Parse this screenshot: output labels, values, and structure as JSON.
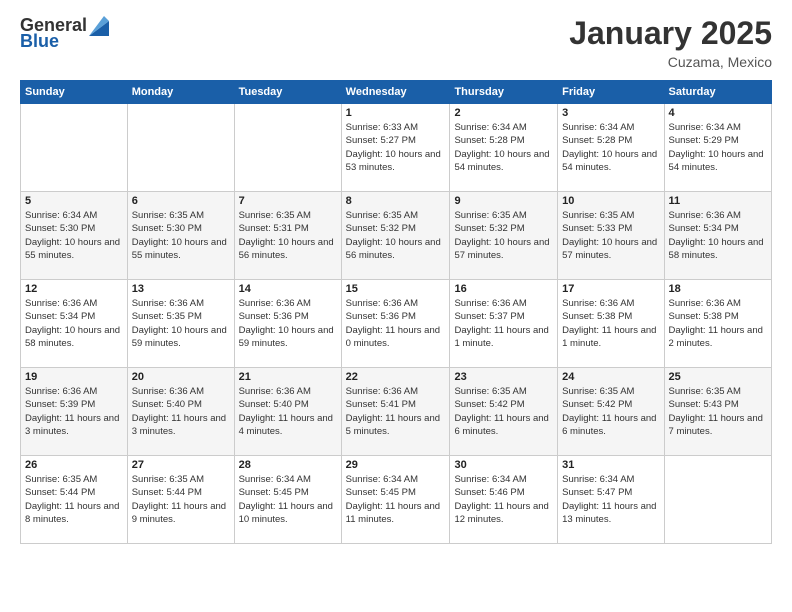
{
  "header": {
    "logo": {
      "general": "General",
      "blue": "Blue"
    },
    "title": "January 2025",
    "location": "Cuzama, Mexico"
  },
  "weekdays": [
    "Sunday",
    "Monday",
    "Tuesday",
    "Wednesday",
    "Thursday",
    "Friday",
    "Saturday"
  ],
  "weeks": [
    [
      {
        "day": "",
        "sunrise": "",
        "sunset": "",
        "daylight": ""
      },
      {
        "day": "",
        "sunrise": "",
        "sunset": "",
        "daylight": ""
      },
      {
        "day": "",
        "sunrise": "",
        "sunset": "",
        "daylight": ""
      },
      {
        "day": "1",
        "sunrise": "Sunrise: 6:33 AM",
        "sunset": "Sunset: 5:27 PM",
        "daylight": "Daylight: 10 hours and 53 minutes."
      },
      {
        "day": "2",
        "sunrise": "Sunrise: 6:34 AM",
        "sunset": "Sunset: 5:28 PM",
        "daylight": "Daylight: 10 hours and 54 minutes."
      },
      {
        "day": "3",
        "sunrise": "Sunrise: 6:34 AM",
        "sunset": "Sunset: 5:28 PM",
        "daylight": "Daylight: 10 hours and 54 minutes."
      },
      {
        "day": "4",
        "sunrise": "Sunrise: 6:34 AM",
        "sunset": "Sunset: 5:29 PM",
        "daylight": "Daylight: 10 hours and 54 minutes."
      }
    ],
    [
      {
        "day": "5",
        "sunrise": "Sunrise: 6:34 AM",
        "sunset": "Sunset: 5:30 PM",
        "daylight": "Daylight: 10 hours and 55 minutes."
      },
      {
        "day": "6",
        "sunrise": "Sunrise: 6:35 AM",
        "sunset": "Sunset: 5:30 PM",
        "daylight": "Daylight: 10 hours and 55 minutes."
      },
      {
        "day": "7",
        "sunrise": "Sunrise: 6:35 AM",
        "sunset": "Sunset: 5:31 PM",
        "daylight": "Daylight: 10 hours and 56 minutes."
      },
      {
        "day": "8",
        "sunrise": "Sunrise: 6:35 AM",
        "sunset": "Sunset: 5:32 PM",
        "daylight": "Daylight: 10 hours and 56 minutes."
      },
      {
        "day": "9",
        "sunrise": "Sunrise: 6:35 AM",
        "sunset": "Sunset: 5:32 PM",
        "daylight": "Daylight: 10 hours and 57 minutes."
      },
      {
        "day": "10",
        "sunrise": "Sunrise: 6:35 AM",
        "sunset": "Sunset: 5:33 PM",
        "daylight": "Daylight: 10 hours and 57 minutes."
      },
      {
        "day": "11",
        "sunrise": "Sunrise: 6:36 AM",
        "sunset": "Sunset: 5:34 PM",
        "daylight": "Daylight: 10 hours and 58 minutes."
      }
    ],
    [
      {
        "day": "12",
        "sunrise": "Sunrise: 6:36 AM",
        "sunset": "Sunset: 5:34 PM",
        "daylight": "Daylight: 10 hours and 58 minutes."
      },
      {
        "day": "13",
        "sunrise": "Sunrise: 6:36 AM",
        "sunset": "Sunset: 5:35 PM",
        "daylight": "Daylight: 10 hours and 59 minutes."
      },
      {
        "day": "14",
        "sunrise": "Sunrise: 6:36 AM",
        "sunset": "Sunset: 5:36 PM",
        "daylight": "Daylight: 10 hours and 59 minutes."
      },
      {
        "day": "15",
        "sunrise": "Sunrise: 6:36 AM",
        "sunset": "Sunset: 5:36 PM",
        "daylight": "Daylight: 11 hours and 0 minutes."
      },
      {
        "day": "16",
        "sunrise": "Sunrise: 6:36 AM",
        "sunset": "Sunset: 5:37 PM",
        "daylight": "Daylight: 11 hours and 1 minute."
      },
      {
        "day": "17",
        "sunrise": "Sunrise: 6:36 AM",
        "sunset": "Sunset: 5:38 PM",
        "daylight": "Daylight: 11 hours and 1 minute."
      },
      {
        "day": "18",
        "sunrise": "Sunrise: 6:36 AM",
        "sunset": "Sunset: 5:38 PM",
        "daylight": "Daylight: 11 hours and 2 minutes."
      }
    ],
    [
      {
        "day": "19",
        "sunrise": "Sunrise: 6:36 AM",
        "sunset": "Sunset: 5:39 PM",
        "daylight": "Daylight: 11 hours and 3 minutes."
      },
      {
        "day": "20",
        "sunrise": "Sunrise: 6:36 AM",
        "sunset": "Sunset: 5:40 PM",
        "daylight": "Daylight: 11 hours and 3 minutes."
      },
      {
        "day": "21",
        "sunrise": "Sunrise: 6:36 AM",
        "sunset": "Sunset: 5:40 PM",
        "daylight": "Daylight: 11 hours and 4 minutes."
      },
      {
        "day": "22",
        "sunrise": "Sunrise: 6:36 AM",
        "sunset": "Sunset: 5:41 PM",
        "daylight": "Daylight: 11 hours and 5 minutes."
      },
      {
        "day": "23",
        "sunrise": "Sunrise: 6:35 AM",
        "sunset": "Sunset: 5:42 PM",
        "daylight": "Daylight: 11 hours and 6 minutes."
      },
      {
        "day": "24",
        "sunrise": "Sunrise: 6:35 AM",
        "sunset": "Sunset: 5:42 PM",
        "daylight": "Daylight: 11 hours and 6 minutes."
      },
      {
        "day": "25",
        "sunrise": "Sunrise: 6:35 AM",
        "sunset": "Sunset: 5:43 PM",
        "daylight": "Daylight: 11 hours and 7 minutes."
      }
    ],
    [
      {
        "day": "26",
        "sunrise": "Sunrise: 6:35 AM",
        "sunset": "Sunset: 5:44 PM",
        "daylight": "Daylight: 11 hours and 8 minutes."
      },
      {
        "day": "27",
        "sunrise": "Sunrise: 6:35 AM",
        "sunset": "Sunset: 5:44 PM",
        "daylight": "Daylight: 11 hours and 9 minutes."
      },
      {
        "day": "28",
        "sunrise": "Sunrise: 6:34 AM",
        "sunset": "Sunset: 5:45 PM",
        "daylight": "Daylight: 11 hours and 10 minutes."
      },
      {
        "day": "29",
        "sunrise": "Sunrise: 6:34 AM",
        "sunset": "Sunset: 5:45 PM",
        "daylight": "Daylight: 11 hours and 11 minutes."
      },
      {
        "day": "30",
        "sunrise": "Sunrise: 6:34 AM",
        "sunset": "Sunset: 5:46 PM",
        "daylight": "Daylight: 11 hours and 12 minutes."
      },
      {
        "day": "31",
        "sunrise": "Sunrise: 6:34 AM",
        "sunset": "Sunset: 5:47 PM",
        "daylight": "Daylight: 11 hours and 13 minutes."
      },
      {
        "day": "",
        "sunrise": "",
        "sunset": "",
        "daylight": ""
      }
    ]
  ]
}
